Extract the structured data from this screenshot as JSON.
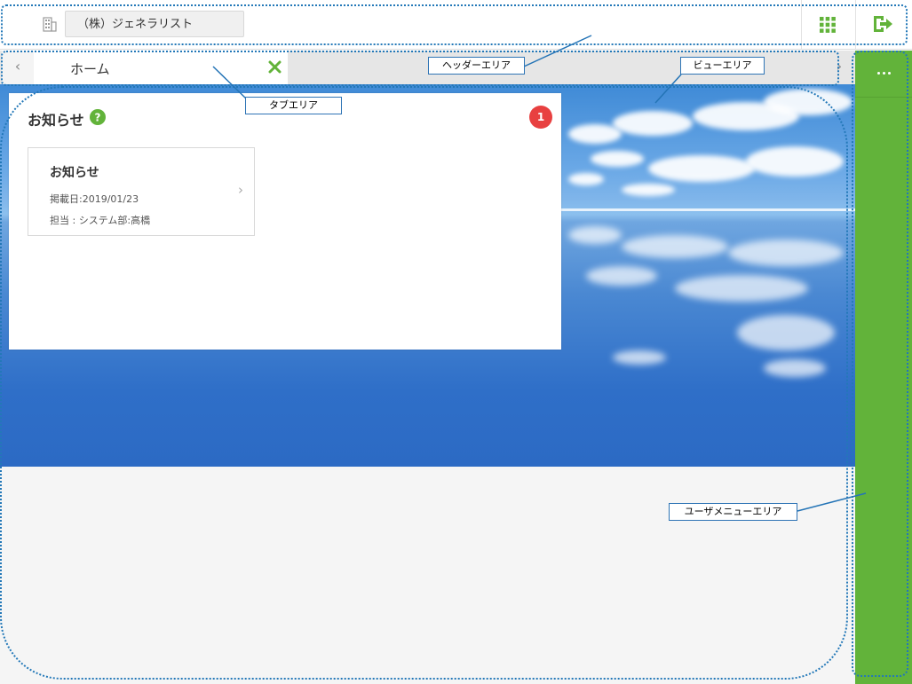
{
  "header": {
    "company_name": "（株）ジェネラリスト",
    "icons": [
      "building-icon",
      "app-grid-icon",
      "logout-icon"
    ]
  },
  "tabs": {
    "prev_glyph": "‹",
    "next_glyph": "›",
    "items": [
      {
        "label": "ホーム",
        "close_icon": "close-icon"
      }
    ]
  },
  "widget": {
    "title": "お知らせ",
    "badge_count": "1",
    "notice": {
      "title": "お知らせ",
      "date": "掲載日:2019/01/23",
      "owner": "担当 : システム部:高橋"
    }
  },
  "user_menu": {
    "more_icon": "more-dots-icon"
  },
  "annotations": {
    "header_area": "ヘッダーエリア",
    "view_area": "ビューエリア",
    "tab_area": "タブエリア",
    "user_menu_area": "ユーザメニューエリア"
  },
  "colors": {
    "accent_green": "#62b33a",
    "badge_red": "#e84040",
    "annotation_blue": "#2e74b5"
  }
}
